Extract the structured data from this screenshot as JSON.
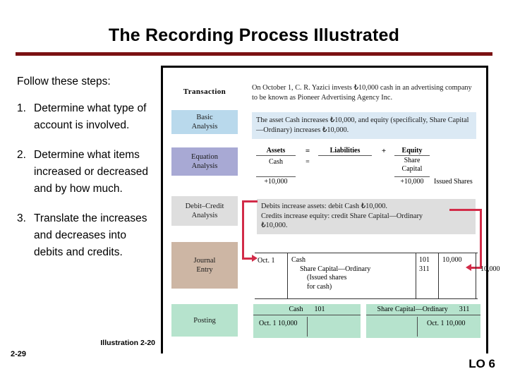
{
  "slide": {
    "title": "The Recording Process Illustrated",
    "page_number": "2-29",
    "lo_tag": "LO 6",
    "illustration_ref": "Illustration 2-20"
  },
  "steps": {
    "lead": "Follow these steps:",
    "items": [
      {
        "num": "1.",
        "text": "Determine what type of account is involved."
      },
      {
        "num": "2.",
        "text": "Determine what items increased or decreased and by how much."
      },
      {
        "num": "3.",
        "text": "Translate the increases and decreases into debits and credits."
      }
    ]
  },
  "illustration": {
    "transaction": {
      "label": "Transaction",
      "text": "On October 1, C. R. Yazici invests ₺10,000 cash in an advertising company to be known as Pioneer Advertising Agency Inc."
    },
    "basic_analysis": {
      "label_line1": "Basic",
      "label_line2": "Analysis",
      "text": "The asset Cash increases ₺10,000, and equity (specifically, Share Capital—Ordinary) increases ₺10,000.",
      "color": "#b9d9ec"
    },
    "equation_analysis": {
      "label_line1": "Equation",
      "label_line2": "Analysis",
      "color": "#a8a9d4",
      "headers": [
        "Assets",
        "Liabilities",
        "Equity"
      ],
      "operators": [
        "=",
        "+"
      ],
      "assets_account": "Cash",
      "assets_equals": "=",
      "equity_account_line1": "Share",
      "equity_account_line2": "Capital",
      "assets_amount": "+10,000",
      "equity_amount": "+10,000",
      "note": "Issued Shares"
    },
    "debit_credit_analysis": {
      "label_line1": "Debit–Credit",
      "label_line2": "Analysis",
      "color": "#dedede",
      "line1": "Debits increase assets: debit Cash ₺10,000.",
      "line2": "Credits increase equity: credit Share Capital—Ordinary",
      "line3": "₺10,000."
    },
    "journal_entry": {
      "label_line1": "Journal",
      "label_line2": "Entry",
      "color": "#cdb6a4",
      "date": "Oct. 1",
      "account_debit": "Cash",
      "account_credit": "Share Capital—Ordinary",
      "memo_line1": "(Issued shares",
      "memo_line2": "for cash)",
      "ref_debit": "101",
      "ref_credit": "311",
      "amount_debit": "10,000",
      "amount_credit": "10,000"
    },
    "posting": {
      "label": "Posting",
      "color": "#b6e3cd",
      "accounts": [
        {
          "name": "Cash",
          "number": "101",
          "side": "debit",
          "entry": "Oct. 1  10,000"
        },
        {
          "name": "Share Capital—Ordinary",
          "number": "311",
          "side": "credit",
          "entry": "Oct. 1  10,000"
        }
      ]
    }
  },
  "colors": {
    "title_rule": "#7B1113",
    "arrow": "#D22B48",
    "basic_bg": "#dbe9f4",
    "debit_bg": "#dedede"
  }
}
